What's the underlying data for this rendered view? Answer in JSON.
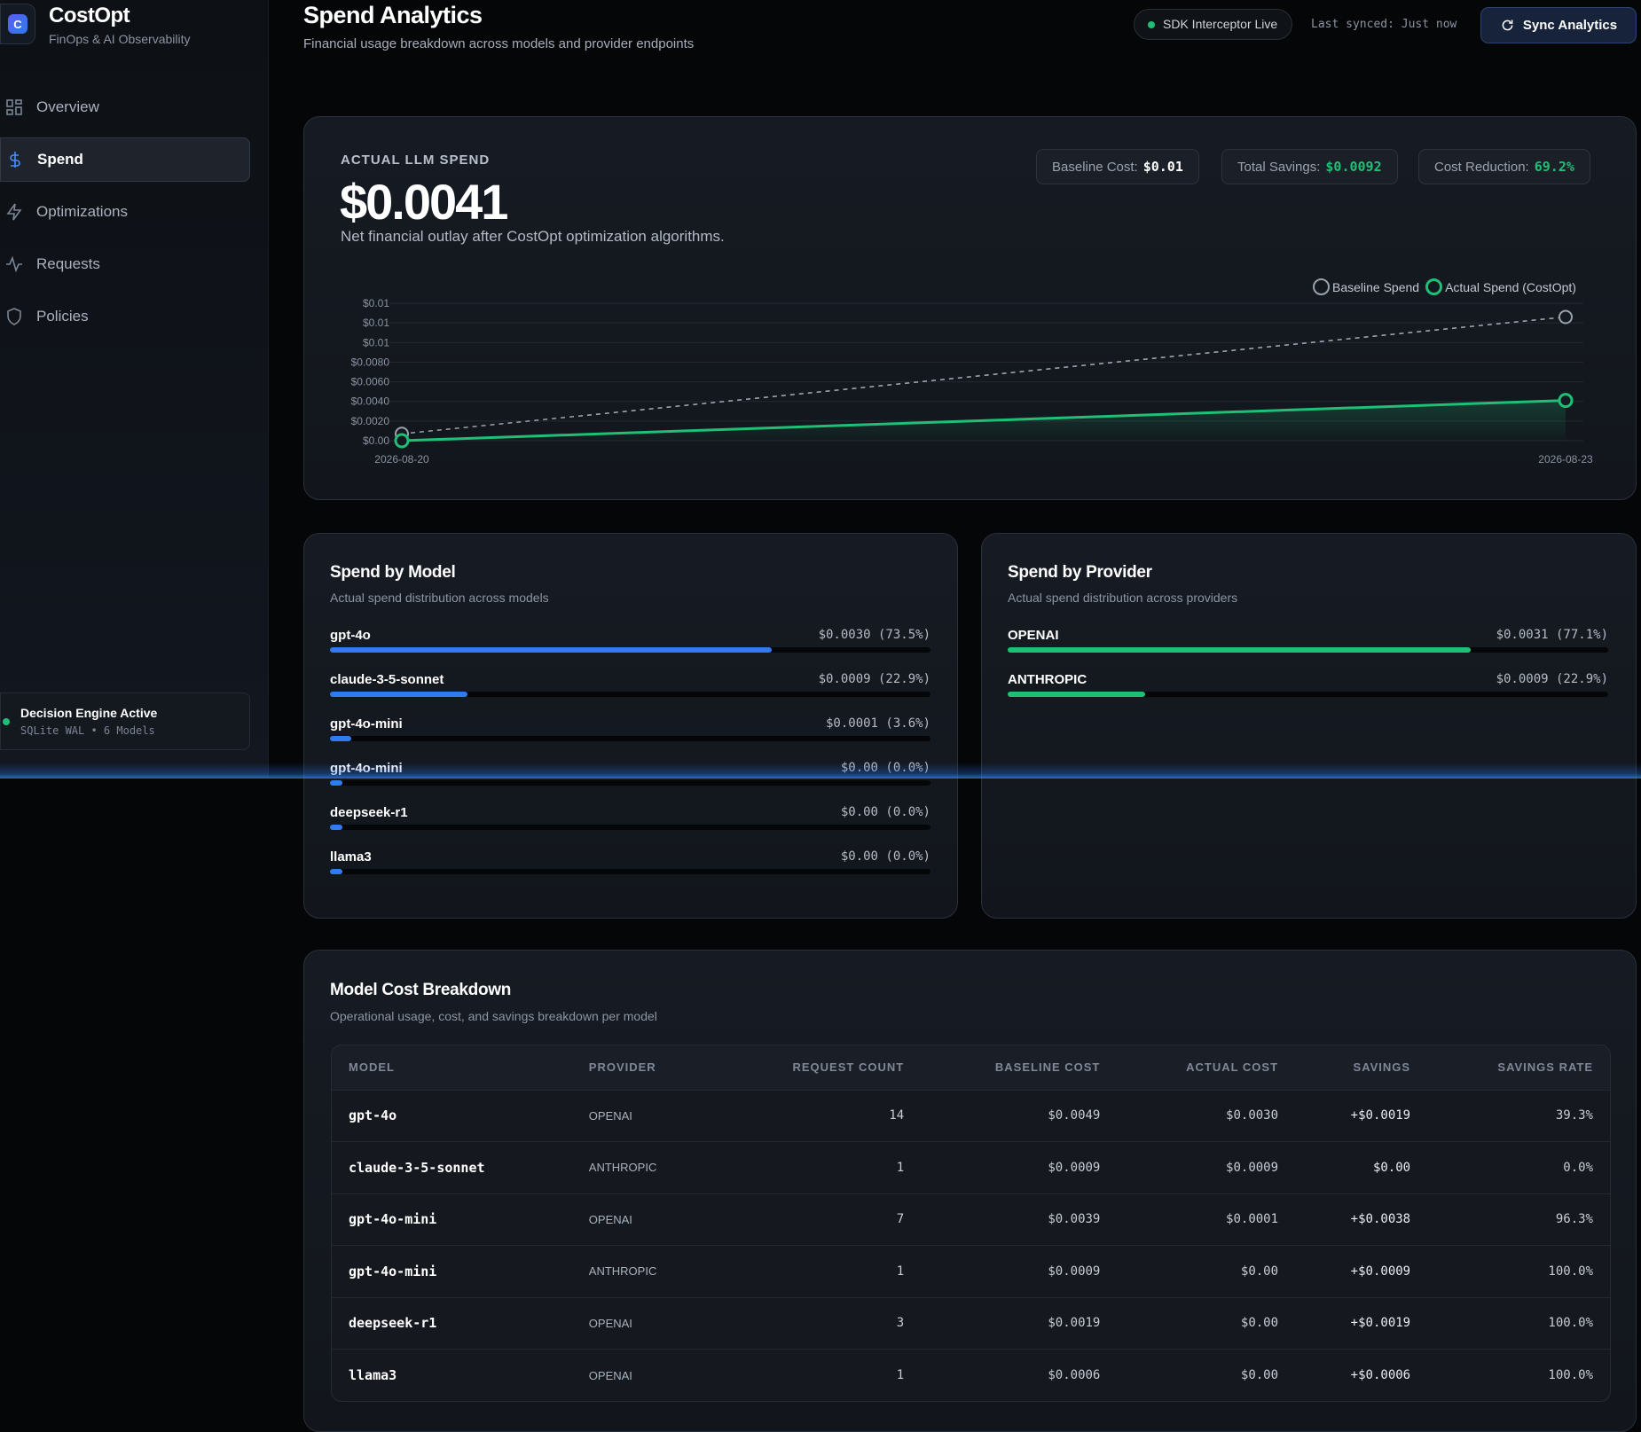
{
  "app": {
    "name": "CostOpt",
    "subtitle": "FinOps & AI Observability",
    "logo_letter": "C"
  },
  "sidebar": {
    "items": [
      {
        "label": "Overview",
        "icon": "grid-icon",
        "active": false
      },
      {
        "label": "Spend",
        "icon": "dollar-icon",
        "active": true
      },
      {
        "label": "Optimizations",
        "icon": "lightning-icon",
        "active": false
      },
      {
        "label": "Requests",
        "icon": "activity-icon",
        "active": false
      },
      {
        "label": "Policies",
        "icon": "shield-icon",
        "active": false
      }
    ],
    "engine": {
      "title": "Decision Engine Active",
      "detail": "SQLite WAL • 6 Models",
      "status_color": "#1fbf76"
    }
  },
  "header": {
    "title": "Spend Analytics",
    "subtitle": "Financial usage breakdown across models and provider endpoints",
    "live_label": "SDK Interceptor Live",
    "synced_label": "Last synced: Just now",
    "sync_button": "Sync Analytics"
  },
  "hero": {
    "label": "ACTUAL LLM SPEND",
    "value": "$0.0041",
    "description": "Net financial outlay after CostOpt optimization algorithms.",
    "stats": [
      {
        "label": "Baseline Cost:",
        "value": "$0.01",
        "color": "#ffffff"
      },
      {
        "label": "Total Savings:",
        "value": "$0.0092",
        "color": "#1fbf76"
      },
      {
        "label": "Cost Reduction:",
        "value": "69.2%",
        "color": "#1fbf76"
      }
    ]
  },
  "chart_data": {
    "type": "line",
    "x": [
      "2026-08-20",
      "2026-08-23"
    ],
    "series": [
      {
        "name": "Baseline Spend",
        "values": [
          0.0007,
          0.0126
        ],
        "color": "#9aa2ae",
        "style": "dashed"
      },
      {
        "name": "Actual Spend (CostOpt)",
        "values": [
          0.0,
          0.0041
        ],
        "color": "#1fbf76",
        "style": "solid"
      }
    ],
    "y_ticks": [
      {
        "value": 0,
        "label": "$0.00"
      },
      {
        "value": 0.002,
        "label": "$0.0020"
      },
      {
        "value": 0.004,
        "label": "$0.0040"
      },
      {
        "value": 0.006,
        "label": "$0.0060"
      },
      {
        "value": 0.008,
        "label": "$0.0080"
      },
      {
        "value": 0.01,
        "label": "$0.01"
      },
      {
        "value": 0.012,
        "label": "$0.01"
      },
      {
        "value": 0.014,
        "label": "$0.01"
      }
    ],
    "x_tick_labels": [
      "2026-08-20",
      "2026-08-23"
    ],
    "ylim": [
      0,
      0.014
    ],
    "legend": "top-right",
    "grid": true,
    "title": "",
    "xlabel": "",
    "ylabel": ""
  },
  "spend_by_model": {
    "title": "Spend by Model",
    "subtitle": "Actual spend distribution across models",
    "bar_color": "#2f7bf0",
    "rows": [
      {
        "name": "gpt-4o",
        "value": "$0.0030 (73.5%)",
        "pct": 73.5
      },
      {
        "name": "claude-3-5-sonnet",
        "value": "$0.0009 (22.9%)",
        "pct": 22.9
      },
      {
        "name": "gpt-4o-mini",
        "value": "$0.0001 (3.6%)",
        "pct": 3.6
      },
      {
        "name": "gpt-4o-mini",
        "value": "$0.00 (0.0%)",
        "pct": 0
      },
      {
        "name": "deepseek-r1",
        "value": "$0.00 (0.0%)",
        "pct": 0
      },
      {
        "name": "llama3",
        "value": "$0.00 (0.0%)",
        "pct": 0
      }
    ]
  },
  "spend_by_provider": {
    "title": "Spend by Provider",
    "subtitle": "Actual spend distribution across providers",
    "bar_color": "#1fbf76",
    "rows": [
      {
        "name": "OPENAI",
        "value": "$0.0031 (77.1%)",
        "pct": 77.1
      },
      {
        "name": "ANTHROPIC",
        "value": "$0.0009 (22.9%)",
        "pct": 22.9
      }
    ]
  },
  "breakdown": {
    "title": "Model Cost Breakdown",
    "subtitle": "Operational usage, cost, and savings breakdown per model",
    "columns": [
      "MODEL",
      "PROVIDER",
      "REQUEST COUNT",
      "BASELINE COST",
      "ACTUAL COST",
      "SAVINGS",
      "SAVINGS RATE"
    ],
    "rows": [
      [
        "gpt-4o",
        "OPENAI",
        "14",
        "$0.0049",
        "$0.0030",
        "+$0.0019",
        "39.3%"
      ],
      [
        "claude-3-5-sonnet",
        "ANTHROPIC",
        "1",
        "$0.0009",
        "$0.0009",
        "$0.00",
        "0.0%"
      ],
      [
        "gpt-4o-mini",
        "OPENAI",
        "7",
        "$0.0039",
        "$0.0001",
        "+$0.0038",
        "96.3%"
      ],
      [
        "gpt-4o-mini",
        "ANTHROPIC",
        "1",
        "$0.0009",
        "$0.00",
        "+$0.0009",
        "100.0%"
      ],
      [
        "deepseek-r1",
        "OPENAI",
        "3",
        "$0.0019",
        "$0.00",
        "+$0.0019",
        "100.0%"
      ],
      [
        "llama3",
        "OPENAI",
        "1",
        "$0.0006",
        "$0.00",
        "+$0.0006",
        "100.0%"
      ]
    ]
  }
}
